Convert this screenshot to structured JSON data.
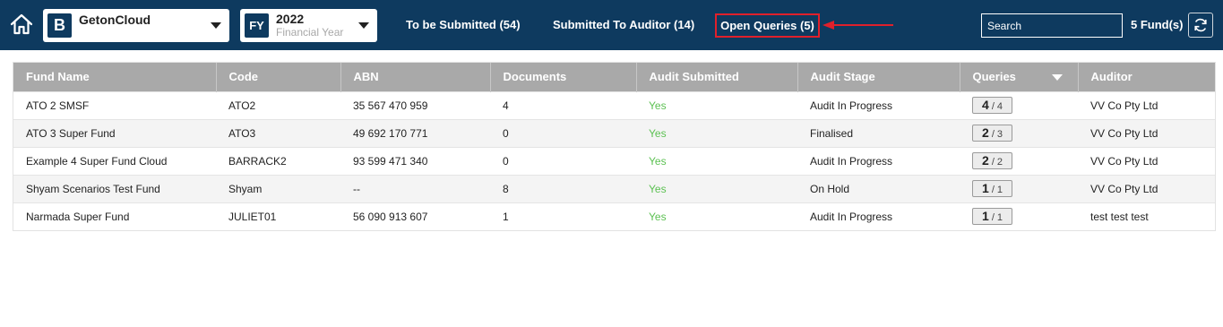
{
  "header": {
    "org": {
      "badge": "B",
      "name": "GetonCloud"
    },
    "fy": {
      "badge": "FY",
      "year": "2022",
      "label": "Financial Year"
    },
    "tabs": [
      {
        "label": "To be Submitted (54)"
      },
      {
        "label": "Submitted To Auditor (14)"
      },
      {
        "label": "Open Queries (5)"
      }
    ],
    "search_placeholder": "Search",
    "fund_count": "5 Fund(s)"
  },
  "table": {
    "columns": [
      "Fund Name",
      "Code",
      "ABN",
      "Documents",
      "Audit Submitted",
      "Audit Stage",
      "Queries",
      "Auditor"
    ],
    "rows": [
      {
        "fund_name": "ATO 2 SMSF",
        "code": "ATO2",
        "abn": "35 567 470 959",
        "documents": "4",
        "audit_submitted": "Yes",
        "audit_stage": "Audit In Progress",
        "queries_open": "4",
        "queries_total": "/ 4",
        "auditor": "VV Co Pty Ltd"
      },
      {
        "fund_name": "ATO 3 Super Fund",
        "code": "ATO3",
        "abn": "49 692 170 771",
        "documents": "0",
        "audit_submitted": "Yes",
        "audit_stage": "Finalised",
        "queries_open": "2",
        "queries_total": "/ 3",
        "auditor": "VV Co Pty Ltd"
      },
      {
        "fund_name": "Example 4 Super Fund Cloud",
        "code": "BARRACK2",
        "abn": "93 599 471 340",
        "documents": "0",
        "audit_submitted": "Yes",
        "audit_stage": "Audit In Progress",
        "queries_open": "2",
        "queries_total": "/ 2",
        "auditor": "VV Co Pty Ltd"
      },
      {
        "fund_name": "Shyam Scenarios Test Fund",
        "code": "Shyam",
        "abn": "--",
        "documents": "8",
        "audit_submitted": "Yes",
        "audit_stage": "On Hold",
        "queries_open": "1",
        "queries_total": "/ 1",
        "auditor": "VV Co Pty Ltd"
      },
      {
        "fund_name": "Narmada Super Fund",
        "code": "JULIET01",
        "abn": "56 090 913 607",
        "documents": "1",
        "audit_submitted": "Yes",
        "audit_stage": "Audit In Progress",
        "queries_open": "1",
        "queries_total": "/ 1",
        "auditor": "test test test"
      }
    ]
  },
  "colors": {
    "header_bg": "#0e3a5f",
    "highlight": "#e0202b",
    "yes_text": "#5cc152",
    "table_header_bg": "#a9a9a9"
  }
}
